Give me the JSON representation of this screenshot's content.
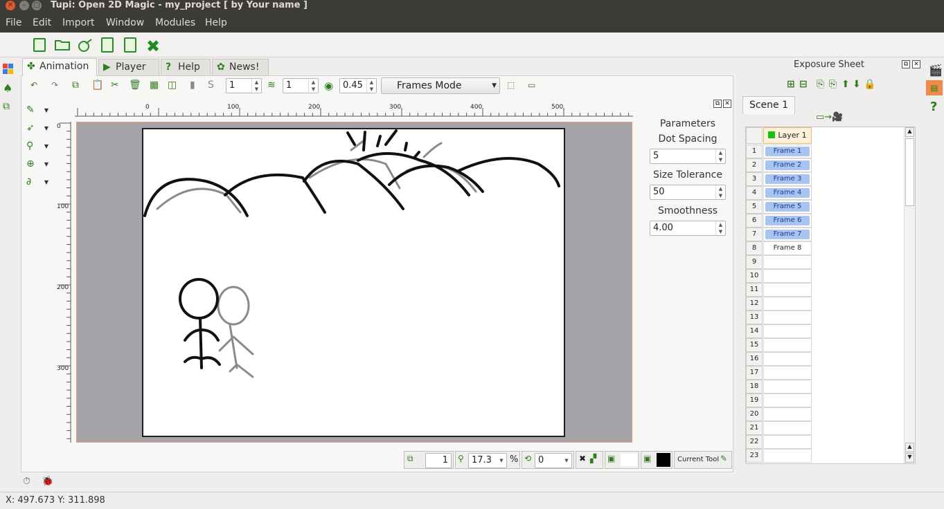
{
  "window": {
    "title": "Tupi: Open 2D Magic - my_project [ by Your name ]"
  },
  "menu": {
    "file": "File",
    "edit": "Edit",
    "import": "Import",
    "window": "Window",
    "modules": "Modules",
    "help": "Help"
  },
  "tabs": {
    "animation": "Animation",
    "player": "Player",
    "help": "Help",
    "news": "News!"
  },
  "animtoolbar": {
    "frame_spin": "1",
    "onion_spin": "1",
    "opacity": "0.45",
    "mode": "Frames Mode"
  },
  "ruler": {
    "h_ticks": [
      "0",
      "100",
      "200",
      "300",
      "400",
      "500"
    ],
    "v_ticks": [
      "0",
      "100",
      "200",
      "300"
    ]
  },
  "params": {
    "title": "Parameters",
    "dot_spacing_label": "Dot Spacing",
    "dot_spacing": "5",
    "size_tolerance_label": "Size Tolerance",
    "size_tolerance": "50",
    "smoothness_label": "Smoothness",
    "smoothness": "4.00"
  },
  "bottombar": {
    "frame": "1",
    "zoom": "17.3",
    "percent": "%",
    "rotation": "0",
    "current_tool": "Current Tool"
  },
  "exposure": {
    "title": "Exposure Sheet",
    "scene": "Scene 1",
    "layer": "Layer 1",
    "rows": [
      "1",
      "2",
      "3",
      "4",
      "5",
      "6",
      "7",
      "8",
      "9",
      "10",
      "11",
      "12",
      "13",
      "14",
      "15",
      "16",
      "17",
      "18",
      "19",
      "20",
      "21",
      "22",
      "23"
    ],
    "frames": [
      "Frame 1",
      "Frame 2",
      "Frame 3",
      "Frame 4",
      "Frame 5",
      "Frame 6",
      "Frame 7",
      "Frame 8"
    ]
  },
  "status": {
    "coords": "X: 497.673 Y: 311.898"
  },
  "colors": {
    "accent_green": "#2f7d1f",
    "frame_blue": "#a8c4f0",
    "stage_gray": "#a3a3a8",
    "titlebar": "#3c3b37"
  }
}
